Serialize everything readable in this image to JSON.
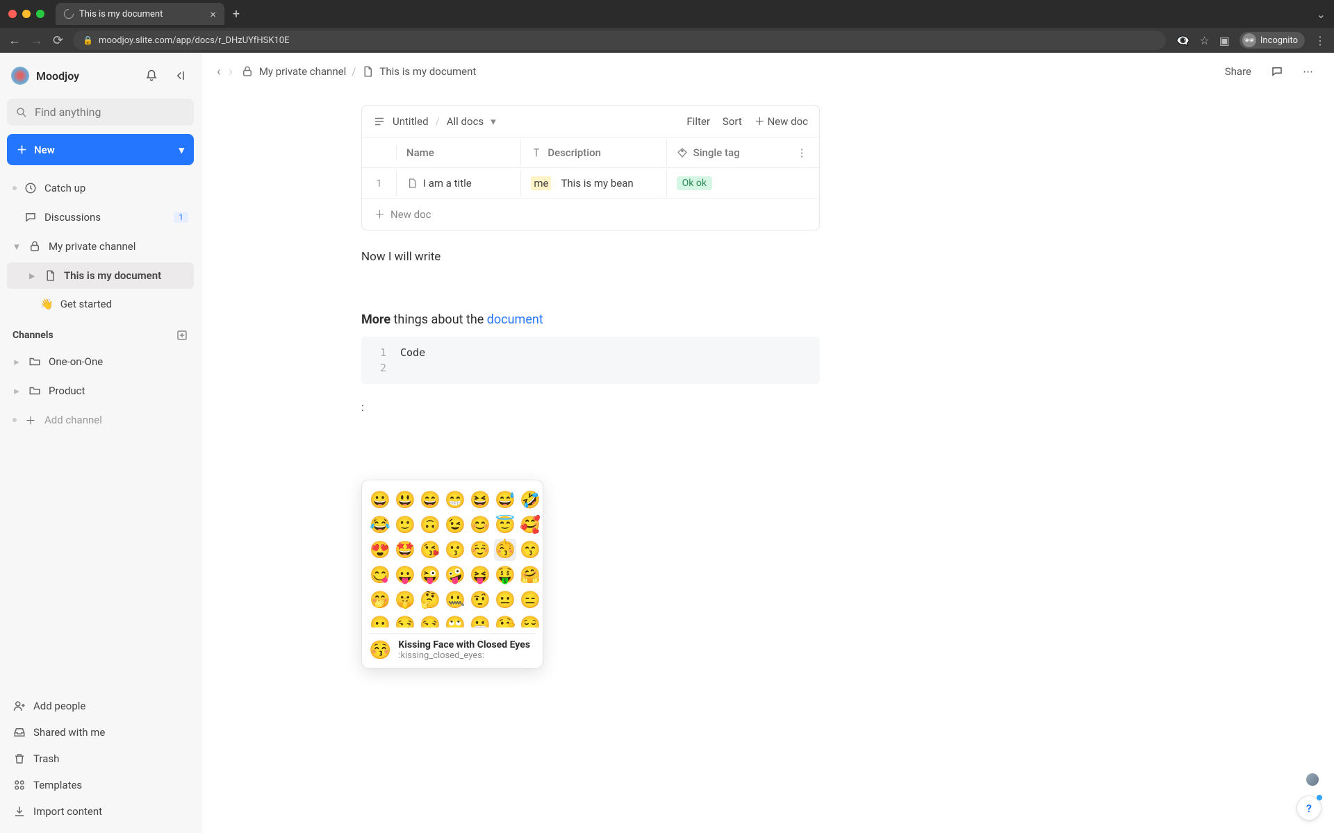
{
  "browser": {
    "tab_title": "This is my document",
    "url": "moodjoy.slite.com/app/docs/r_DHzUYfHSK10E",
    "incognito_label": "Incognito"
  },
  "workspace": {
    "name": "Moodjoy"
  },
  "search": {
    "placeholder": "Find anything"
  },
  "new_button": {
    "label": "New"
  },
  "sidebar": {
    "catch_up": "Catch up",
    "discussions": "Discussions",
    "discussions_badge": "1",
    "my_channel": "My private channel",
    "doc_current": "This is my document",
    "get_started": "Get started",
    "get_started_emoji": "👋",
    "channels_header": "Channels",
    "one_on_one": "One-on-One",
    "product": "Product",
    "add_channel": "Add channel",
    "add_people": "Add people",
    "shared": "Shared with me",
    "trash": "Trash",
    "templates": "Templates",
    "import": "Import content"
  },
  "breadcrumb": {
    "channel": "My private channel",
    "doc": "This is my document"
  },
  "topbar": {
    "share": "Share"
  },
  "database": {
    "title": "Untitled",
    "view": "All docs",
    "filter": "Filter",
    "sort": "Sort",
    "newdoc": "New doc",
    "col_name": "Name",
    "col_desc": "Description",
    "col_tag": "Single tag",
    "row_index": "1",
    "row_name": "I am a title",
    "row_desc_hl": "me",
    "row_desc": "This is my bean",
    "row_tag": "Ok ok",
    "add_row": "New doc"
  },
  "paragraph1": "Now I will write",
  "richline": {
    "bold": "More",
    "mid": " things about the ",
    "link": "document"
  },
  "code": {
    "line1_num": "1",
    "line1_text": "Code",
    "line2_num": "2"
  },
  "trigger_text": ":",
  "emoji_picker": {
    "rows": [
      [
        "😀",
        "😃",
        "😄",
        "😁",
        "😆",
        "😅",
        "🤣"
      ],
      [
        "😂",
        "🙂",
        "🙃",
        "😉",
        "😊",
        "😇",
        "🥰"
      ],
      [
        "😍",
        "🤩",
        "😘",
        "😗",
        "☺️",
        "😚",
        "😙"
      ],
      [
        "😋",
        "😛",
        "😜",
        "🤪",
        "😝",
        "🤑",
        "🤗"
      ],
      [
        "🤭",
        "🤫",
        "🤔",
        "🤐",
        "🤨",
        "😐",
        "😑"
      ],
      [
        "😶",
        "😏",
        "😒",
        "🙄",
        "😬",
        "🤥",
        "😌"
      ]
    ],
    "hover_index": [
      2,
      5
    ],
    "selected_name": "Kissing Face with Closed Eyes",
    "selected_shortcode": ":kissing_closed_eyes:",
    "selected_emoji": "😚"
  },
  "help": "?"
}
